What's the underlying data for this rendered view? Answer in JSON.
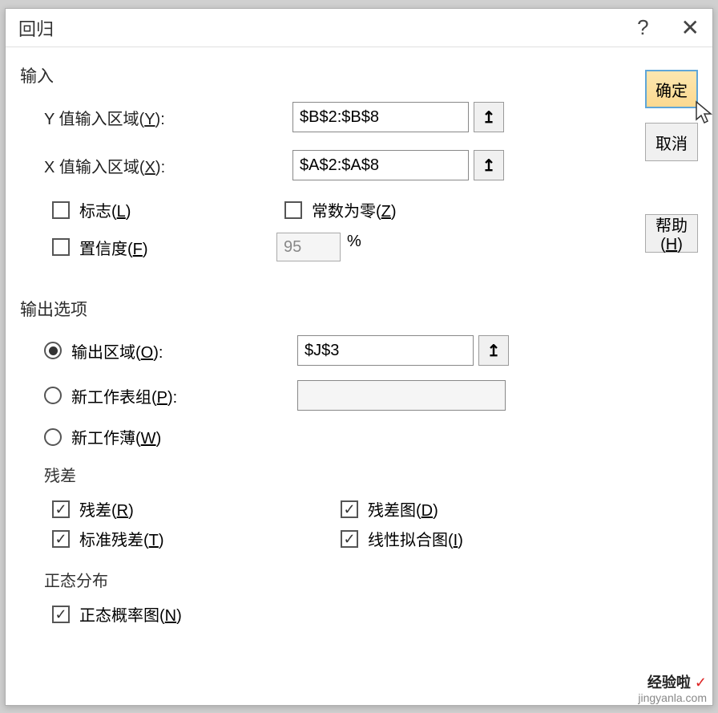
{
  "dialog": {
    "title": "回归",
    "help_icon": "?",
    "close_icon": "✕"
  },
  "buttons": {
    "ok": "确定",
    "cancel": "取消",
    "help": "帮助(H)"
  },
  "input_section": {
    "label": "输入",
    "y_label": "Y 值输入区域(Y):",
    "y_value": "$B$2:$B$8",
    "x_label": "X 值输入区域(X):",
    "x_value": "$A$2:$A$8",
    "flag_label": "标志(L)",
    "const_zero_label": "常数为零(Z)",
    "confidence_label": "置信度(F)",
    "confidence_value": "95",
    "percent": "%"
  },
  "output_section": {
    "label": "输出选项",
    "output_range_label": "输出区域(O):",
    "output_range_value": "$J$3",
    "new_sheet_label": "新工作表组(P):",
    "new_sheet_value": "",
    "new_book_label": "新工作薄(W)"
  },
  "residual_section": {
    "label": "残差",
    "residual_label": "残差(R)",
    "residual_plot_label": "残差图(D)",
    "std_residual_label": "标准残差(T)",
    "line_fit_label": "线性拟合图(I)"
  },
  "normal_section": {
    "label": "正态分布",
    "normal_prob_label": "正态概率图(N)"
  },
  "range_icon": "↥",
  "watermark": {
    "top": "经验啦",
    "check": "✓",
    "bottom": "jingyanla.com"
  }
}
